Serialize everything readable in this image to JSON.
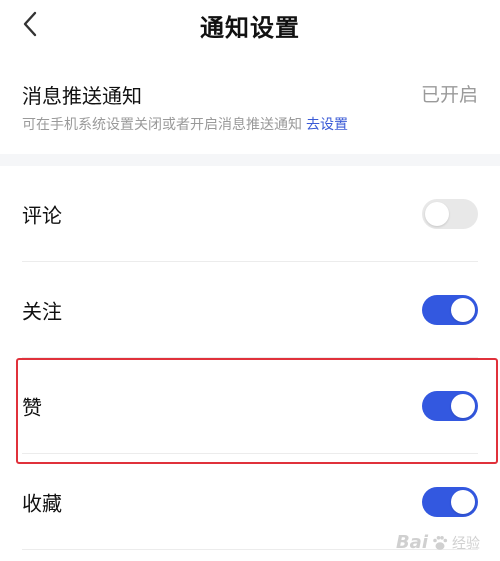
{
  "header": {
    "title": "通知设置",
    "back_icon": "chevron-left-icon"
  },
  "push_notification": {
    "title": "消息推送通知",
    "status": "已开启",
    "description": "可在手机系统设置关闭或者开启消息推送通知",
    "link_label": "去设置"
  },
  "settings": [
    {
      "label": "评论",
      "enabled": false
    },
    {
      "label": "关注",
      "enabled": true
    },
    {
      "label": "赞",
      "enabled": true
    },
    {
      "label": "收藏",
      "enabled": true
    }
  ],
  "colors": {
    "toggle_on": "#3358e0",
    "toggle_off": "#e8e8e8",
    "link": "#3a5ad6",
    "highlight": "#e0313b"
  },
  "watermark": {
    "brand": "Bai",
    "suffix": "经验"
  }
}
